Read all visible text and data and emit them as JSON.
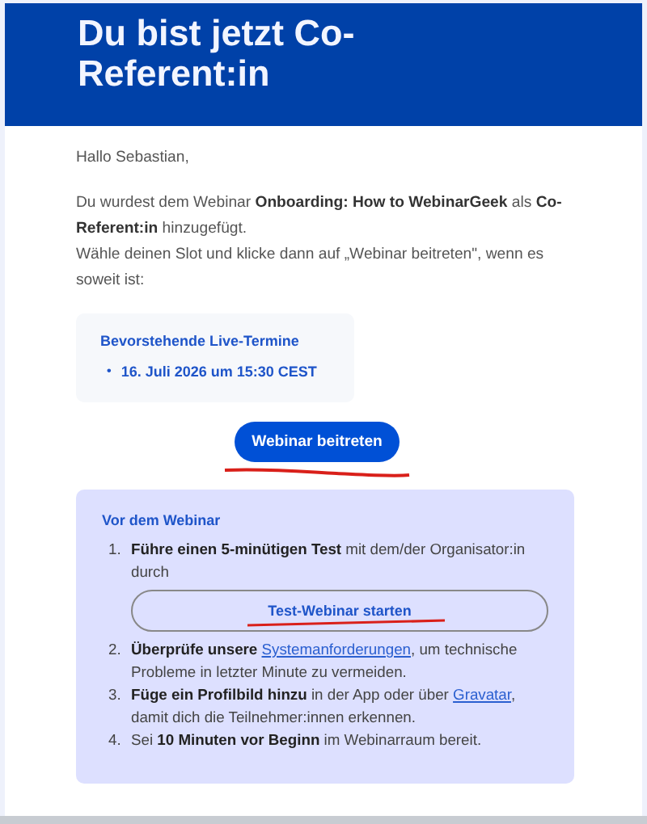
{
  "header": {
    "title": "Du bist jetzt Co-Referent:in"
  },
  "greeting": "Hallo Sebastian,",
  "intro": [
    "Du wurdest dem Webinar **Onboarding: How to WebinarGeek** als **Co-Referent:in** hinzugefügt.",
    "Wähle deinen Slot und klicke dann auf „Webinar beitreten\", wenn es soweit ist:"
  ],
  "sessions": {
    "title": "Bevorstehende Live-Termine",
    "items": [
      {
        "bullet": "•",
        "text": "16. Juli 2026 um 15:30 CEST"
      }
    ]
  },
  "join_button": {
    "label": "Webinar beitreten"
  },
  "before": {
    "title": "Vor dem Webinar",
    "steps": [
      {
        "number": "1.",
        "parts": [
          {
            "kind": "bold",
            "text": "Führe einen 5-minütigen Test"
          },
          {
            "kind": "text",
            "text": " mit dem/der Organisator:in durch"
          }
        ],
        "button": "Test-Webinar starten"
      },
      {
        "number": "2.",
        "parts": [
          {
            "kind": "bold",
            "text": "Überprüfe unsere "
          },
          {
            "kind": "link",
            "text": "Systemanforderungen"
          },
          {
            "kind": "text",
            "text": ", um technische Probleme in letzter Minute zu vermeiden."
          }
        ]
      },
      {
        "number": "3.",
        "parts": [
          {
            "kind": "bold",
            "text": "Füge ein Profilbild hinzu"
          },
          {
            "kind": "text",
            "text": " in der App oder über "
          },
          {
            "kind": "link",
            "text": "Gravatar"
          },
          {
            "kind": "text",
            "text": ", damit dich die Teilnehmer:innen erkennen."
          }
        ]
      },
      {
        "number": "4.",
        "parts": [
          {
            "kind": "text",
            "text": "Sei "
          },
          {
            "kind": "bold",
            "text": "10 Minuten vor Beginn"
          },
          {
            "kind": "text",
            "text": " im Webinarraum bereit."
          }
        ]
      }
    ]
  }
}
